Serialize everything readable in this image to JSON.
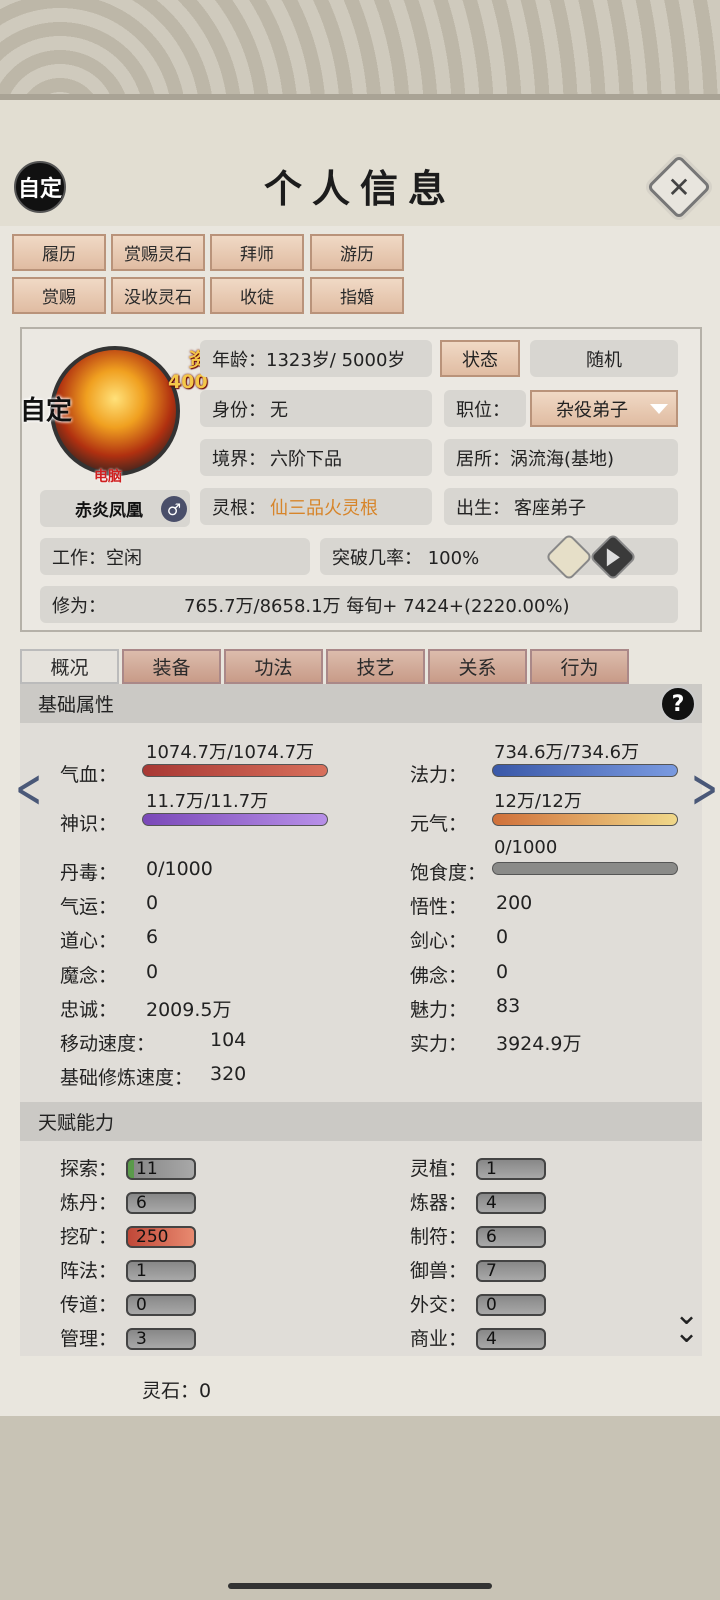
{
  "header": {
    "title": "个人信息",
    "auto_label": "自定",
    "close_symbol": "✕"
  },
  "actions": [
    "履历",
    "赏赐灵石",
    "拜师",
    "游历",
    "赏赐",
    "没收灵石",
    "收徒",
    "指婚"
  ],
  "avatar": {
    "auto_label": "自定",
    "aptitude_label": "资",
    "aptitude_value": "400",
    "device_label": "电脑"
  },
  "character": {
    "name": "赤炎凤凰",
    "gender_symbol": "♂"
  },
  "info": {
    "age": "年龄：1323岁/ 5000岁",
    "status_btn": "状态",
    "random_btn": "随机",
    "identity_label": "身份：",
    "identity_value": "无",
    "position_label": "职位：",
    "position_value": "杂役弟子",
    "realm_label": "境界：",
    "realm_value": "六阶下品",
    "residence": "居所：涡流海(基地)",
    "root_label": "灵根：",
    "root_value": "仙三品火灵根",
    "birth_label": "出生：",
    "birth_value": "客座弟子",
    "work": "工作：空闲",
    "breakthrough": "突破几率：  100%",
    "cultivation_label": "修为：",
    "cultivation_value": "765.7万/8658.1万  每旬+  7424+(2220.00%)"
  },
  "tabs": [
    "概况",
    "装备",
    "功法",
    "技艺",
    "关系",
    "行为"
  ],
  "basic": {
    "title": "基础属性",
    "help": "?",
    "hp_label": "气血：",
    "hp_value": "1074.7万/1074.7万",
    "hp_ratio": 1.0,
    "mana_label": "法力：",
    "mana_value": "734.6万/734.6万",
    "mana_ratio": 1.0,
    "sense_label": "神识：",
    "sense_value": "11.7万/11.7万",
    "sense_ratio": 1.0,
    "vital_label": "元气：",
    "vital_value": "12万/12万",
    "vital_ratio": 1.0,
    "satiety_label": "饱食度：",
    "satiety_value": "0/1000",
    "satiety_ratio": 0.0,
    "stats": [
      {
        "l": "丹毒：",
        "v": "0/1000"
      },
      {
        "l": "气运：",
        "v": "0"
      },
      {
        "l": "悟性：",
        "v": "200"
      },
      {
        "l": "道心：",
        "v": "6"
      },
      {
        "l": "剑心：",
        "v": "0"
      },
      {
        "l": "魔念：",
        "v": "0"
      },
      {
        "l": "佛念：",
        "v": "0"
      },
      {
        "l": "忠诚：",
        "v": "2009.5万"
      },
      {
        "l": "魅力：",
        "v": "83"
      },
      {
        "l": "移动速度：",
        "v": "104"
      },
      {
        "l": "实力：",
        "v": "3924.9万"
      },
      {
        "l": "基础修炼速度：",
        "v": "320"
      }
    ]
  },
  "talent": {
    "title": "天赋能力",
    "items": [
      {
        "l": "探索：",
        "v": "11"
      },
      {
        "l": "灵植：",
        "v": "1"
      },
      {
        "l": "炼丹：",
        "v": "6"
      },
      {
        "l": "炼器：",
        "v": "4"
      },
      {
        "l": "挖矿：",
        "v": "250"
      },
      {
        "l": "制符：",
        "v": "6"
      },
      {
        "l": "阵法：",
        "v": "1"
      },
      {
        "l": "御兽：",
        "v": "7"
      },
      {
        "l": "传道：",
        "v": "0"
      },
      {
        "l": "外交：",
        "v": "0"
      },
      {
        "l": "管理：",
        "v": "3"
      },
      {
        "l": "商业：",
        "v": "4"
      }
    ]
  },
  "footer": {
    "spirit_stone": "灵石：0"
  },
  "colors": {
    "hp": "#b84a44",
    "mana": "#4a6ab8",
    "sense": "#8a5ac0",
    "vital": "#d08840",
    "root": "#d7852a",
    "button": "#e6c8b2"
  },
  "icons": {
    "prev": "chevron-left-icon",
    "next": "chevron-right-icon",
    "scroll": "double-chevron-down-icon"
  }
}
